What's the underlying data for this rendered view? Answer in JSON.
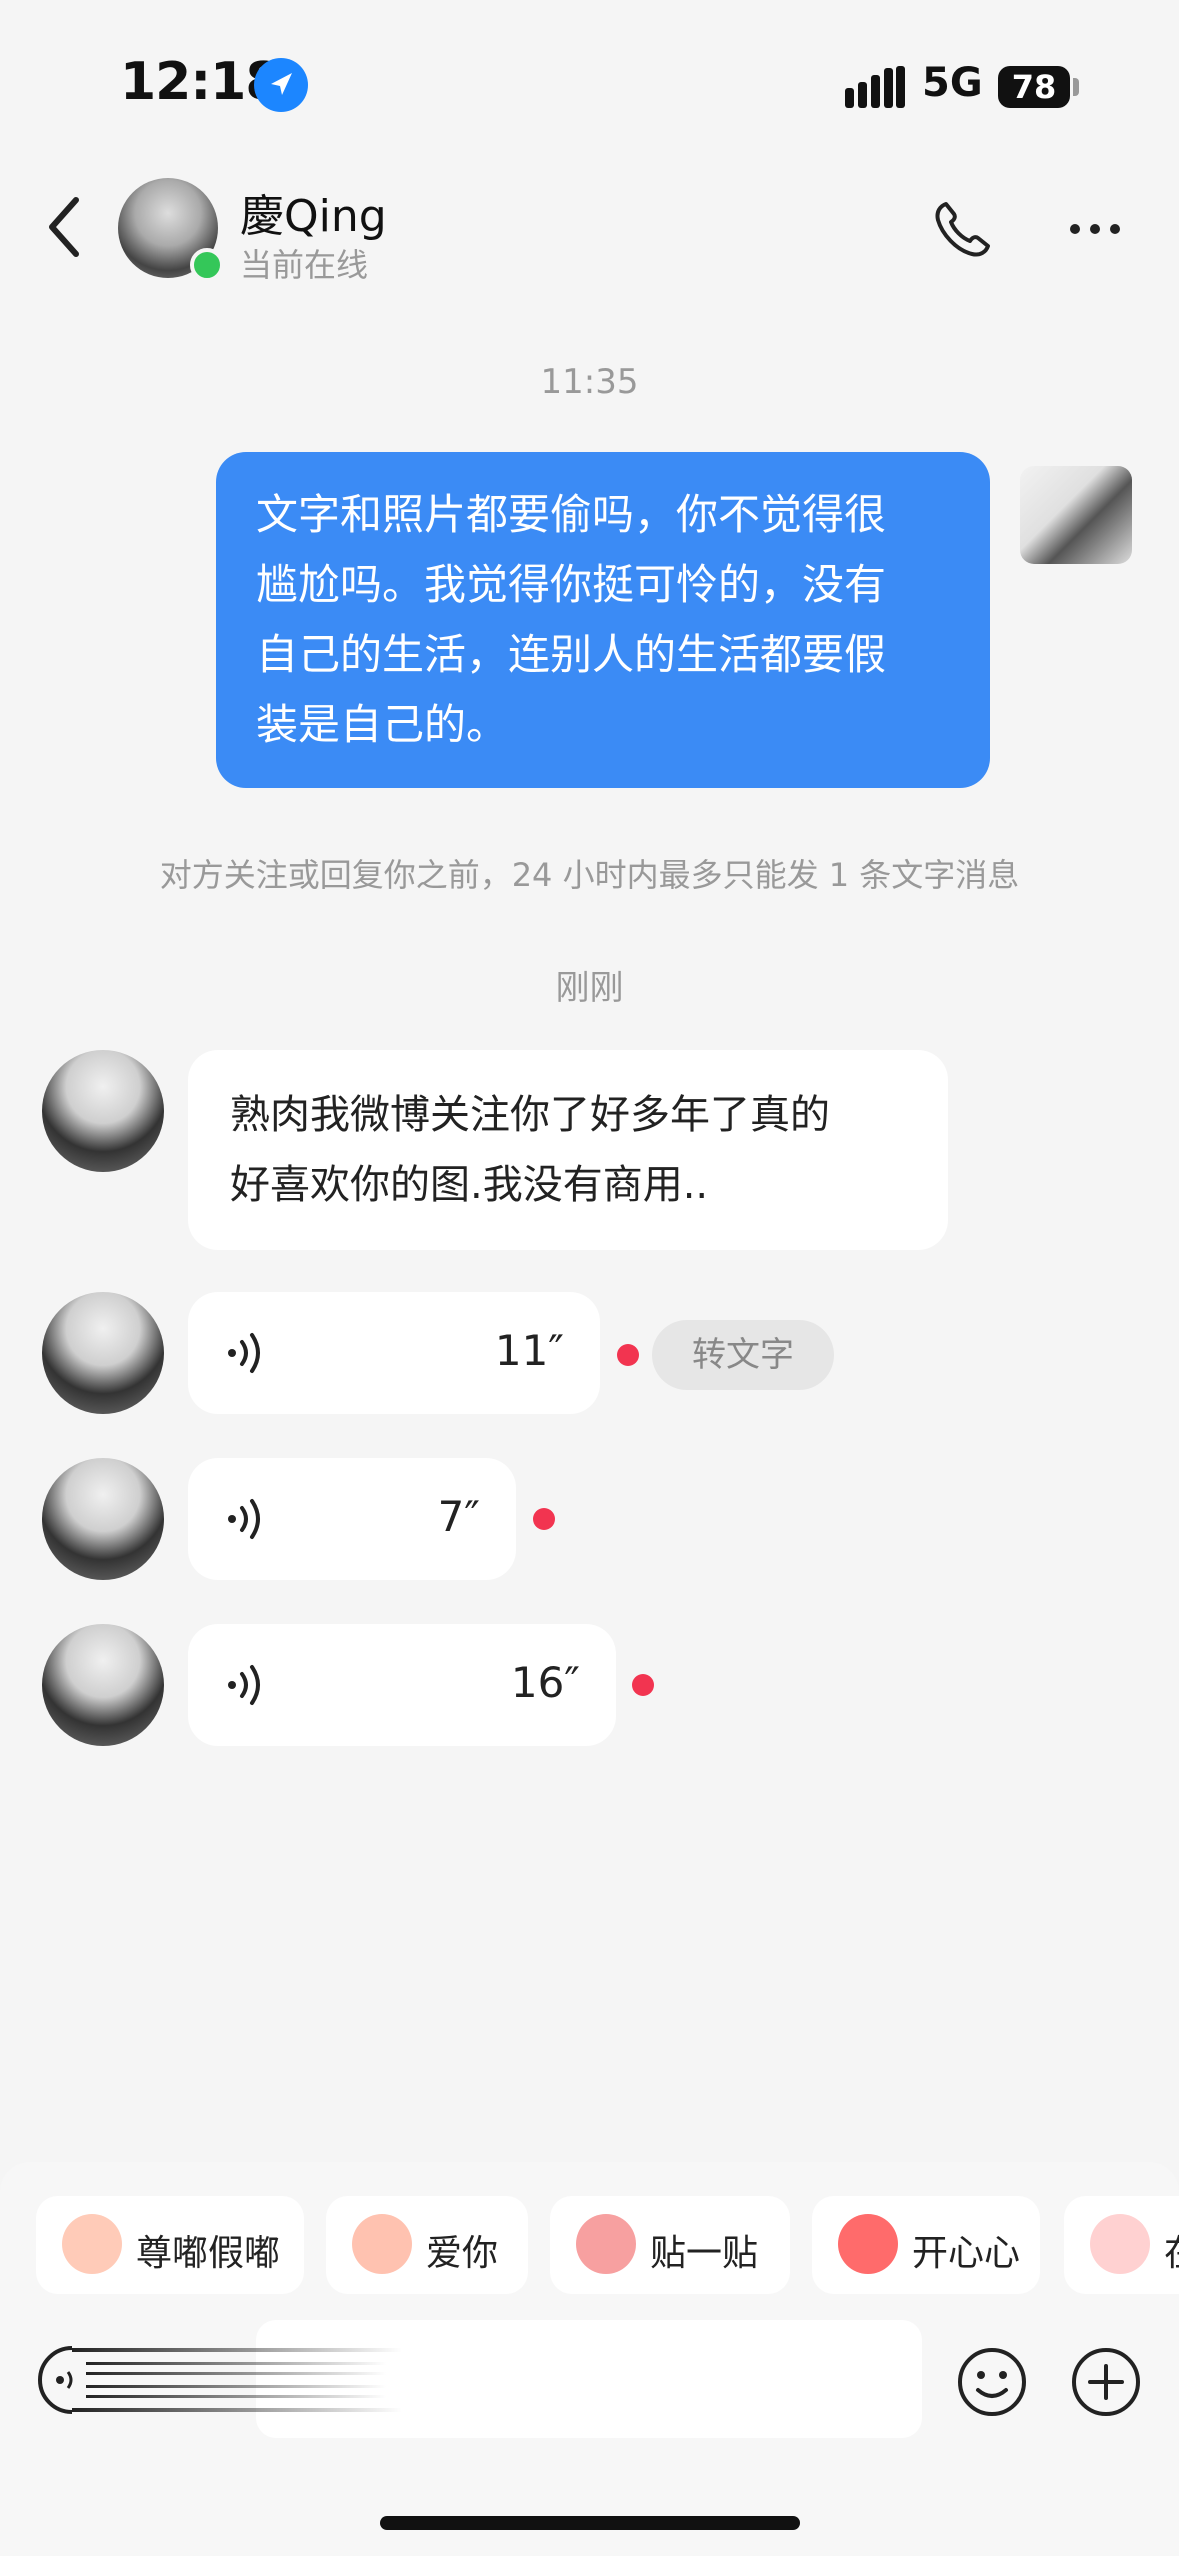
{
  "status_bar": {
    "time": "12:18",
    "network": "5G",
    "battery": "78"
  },
  "header": {
    "name": "慶Qing",
    "status": "当前在线"
  },
  "messages": {
    "time1": "11:35",
    "outgoing": {
      "lines": [
        "文字和照片都要偷吗，你不觉得很",
        "尴尬吗。我觉得你挺可怜的，没有",
        "自己的生活，连别人的生活都要假",
        "装是自己的。"
      ]
    },
    "notice": "对方关注或回复你之前，24 小时内最多只能发 1 条文字消息",
    "time2": "刚刚",
    "incoming_text": {
      "lines": [
        "熟肉我微博关注你了好多年了真的",
        "好喜欢你的图.我没有商用.."
      ]
    },
    "voices": [
      {
        "duration": "11″",
        "unread": true
      },
      {
        "duration": "7″",
        "unread": true
      },
      {
        "duration": "16″",
        "unread": true
      }
    ],
    "to_text_label": "转文字"
  },
  "stickers": [
    {
      "label": "尊嘟假嘟",
      "color": "#ffcbb8"
    },
    {
      "label": "爱你",
      "color": "#ffc2b0"
    },
    {
      "label": "贴一贴",
      "color": "#f7a0a0"
    },
    {
      "label": "开心心",
      "color": "#ff6b6b"
    },
    {
      "label": "在",
      "color": "#ffd1d1"
    }
  ],
  "colors": {
    "accent": "#3b8bf5",
    "online": "#34c759",
    "unread": "#f23450"
  }
}
